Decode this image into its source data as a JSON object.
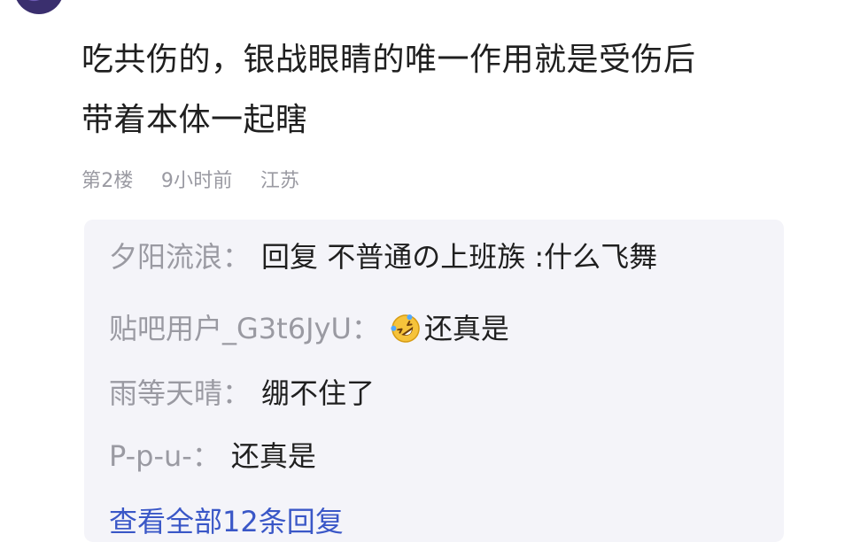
{
  "post": {
    "line1": "吃共伤的，银战眼睛的唯一作用就是受伤后",
    "line2": "带着本体一起瞎",
    "meta": {
      "floor": "第2楼",
      "time": "9小时前",
      "location": "江苏"
    }
  },
  "replies": [
    {
      "user": "夕阳流浪",
      "text": "回复 不普通の上班族 :什么飞舞"
    },
    {
      "user": "贴吧用户_G3t6JyU",
      "emoji": "rolling-on-floor-laughing-icon",
      "text": "还真是"
    },
    {
      "user": "雨等天晴",
      "text": "绷不住了"
    },
    {
      "user": "P-p-u-",
      "text": "还真是"
    }
  ],
  "view_all_label": "查看全部12条回复",
  "colors": {
    "meta_gray": "#9a9aa2",
    "reply_bg": "#f4f4f9",
    "link_blue": "#3a57c7",
    "text_dark": "#1f1f1f"
  },
  "separator": "："
}
